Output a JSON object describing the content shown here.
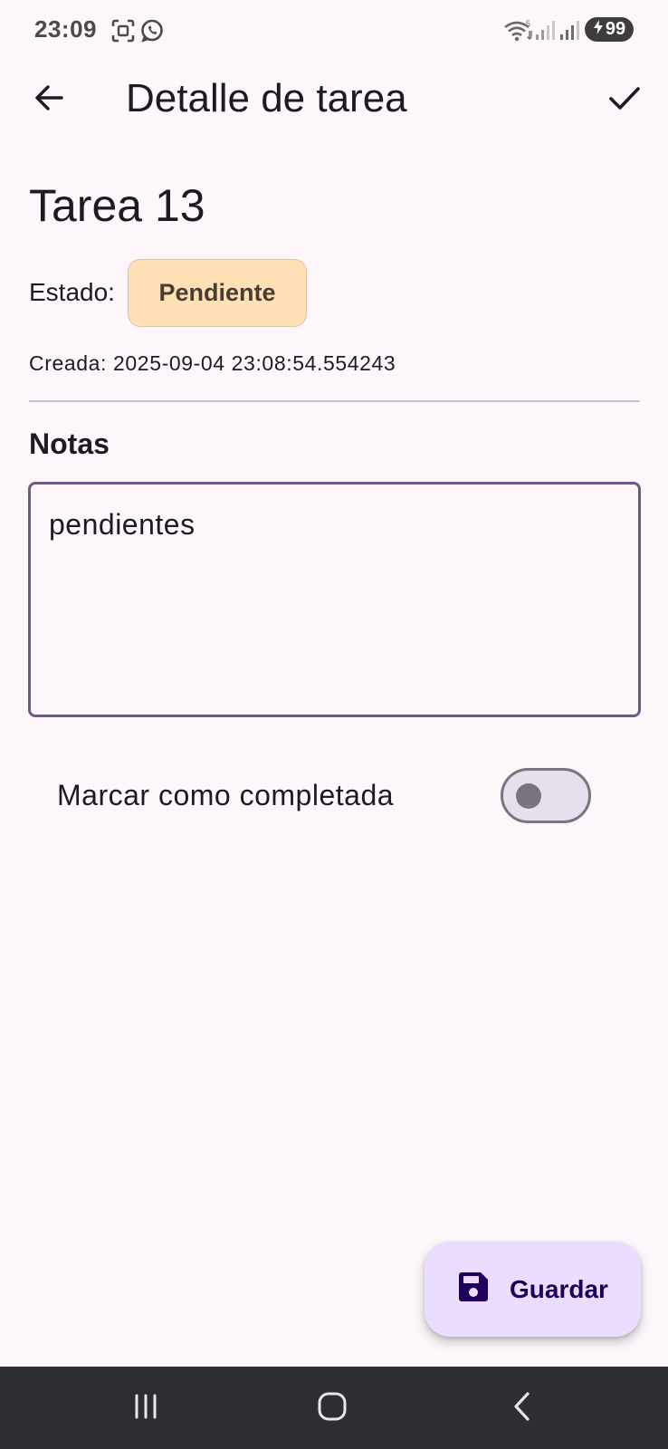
{
  "status_bar": {
    "time": "23:09",
    "battery": "99",
    "icons": [
      "screen-capture-icon",
      "whatsapp-icon",
      "wifi-icon",
      "signal-icon",
      "battery-charging-icon"
    ]
  },
  "app_bar": {
    "title": "Detalle de tarea",
    "back_icon": "arrow-back-icon",
    "confirm_icon": "check-icon"
  },
  "task": {
    "title": "Tarea 13",
    "status_label": "Estado:",
    "status_value": "Pendiente",
    "created_text": "Creada: 2025-09-04 23:08:54.554243"
  },
  "notes": {
    "heading": "Notas",
    "value": "pendientes"
  },
  "completion": {
    "label": "Marcar como completada",
    "checked": false
  },
  "fab": {
    "label": "Guardar",
    "icon": "save-icon"
  },
  "nav_bar": {
    "icons": [
      "recent-apps-icon",
      "home-icon",
      "back-icon"
    ]
  },
  "colors": {
    "background": "#fdf7fc",
    "status_chip": "#ffe1b5",
    "notes_border": "#6f5a85",
    "fab_background": "#eaddff",
    "nav_bar": "#2e2d31"
  }
}
